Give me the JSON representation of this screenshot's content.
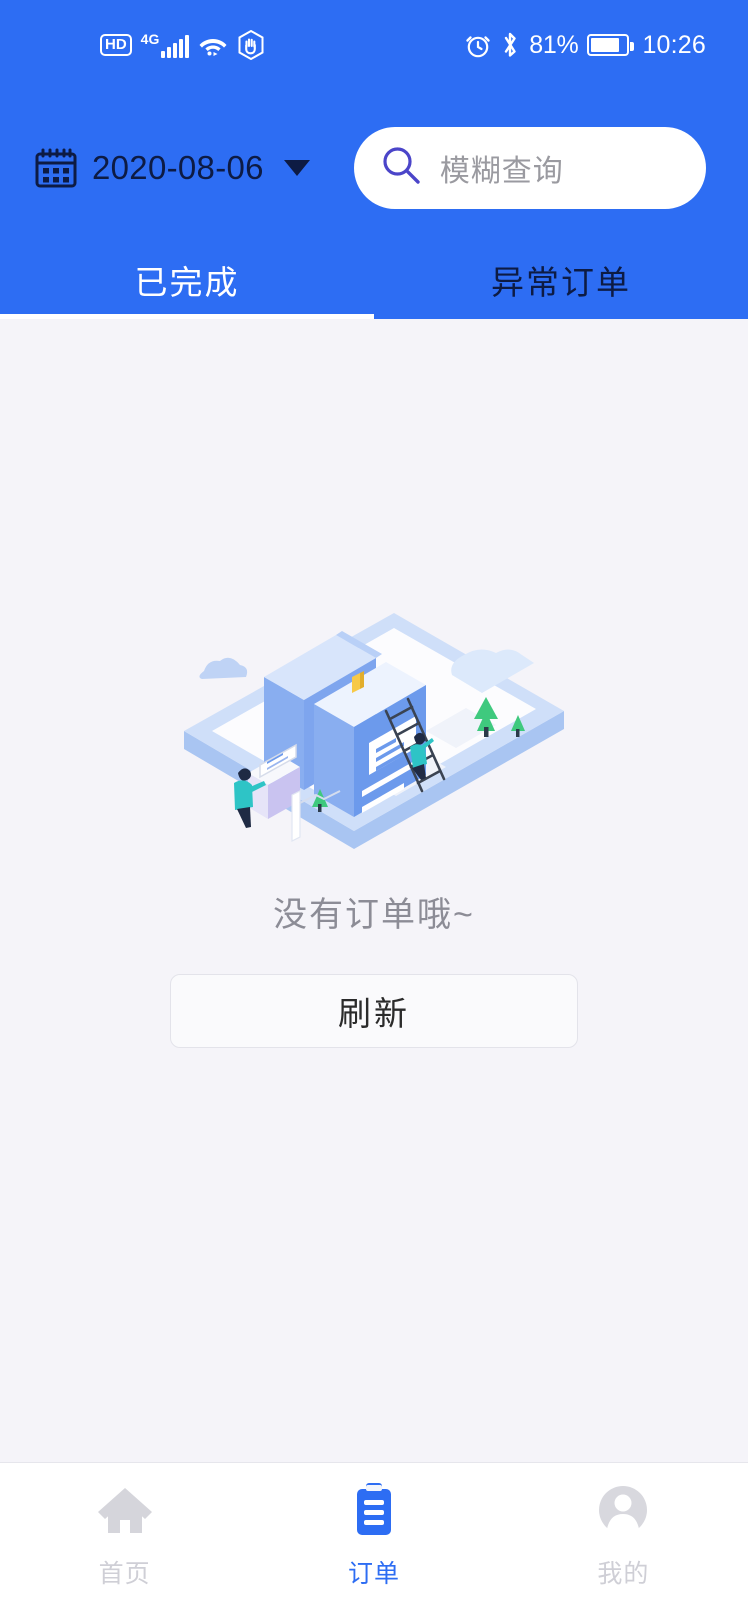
{
  "status_bar": {
    "hd_badge": "HD",
    "network_type": "4G",
    "signal_icon": "signal-bars-icon",
    "wifi_icon": "wifi-icon",
    "dnd_icon": "do-not-disturb-hand-icon",
    "alarm_icon": "alarm-clock-icon",
    "bluetooth_icon": "bluetooth-icon",
    "battery_percent": "81%",
    "battery_icon": "battery-icon",
    "time": "10:26"
  },
  "header": {
    "calendar_icon": "calendar-icon",
    "date": "2020-08-06",
    "caret_icon": "chevron-down-icon",
    "search": {
      "icon": "search-icon",
      "placeholder": "模糊查询",
      "value": ""
    },
    "tabs": [
      {
        "label": "已完成",
        "active": true
      },
      {
        "label": "异常订单",
        "active": false
      }
    ]
  },
  "main": {
    "illustration": "empty-orders-isometric-illustration",
    "empty_text": "没有订单哦~",
    "refresh_label": "刷新"
  },
  "bottom_nav": [
    {
      "label": "首页",
      "icon": "home-icon",
      "active": false
    },
    {
      "label": "订单",
      "icon": "clipboard-icon",
      "active": true
    },
    {
      "label": "我的",
      "icon": "user-avatar-icon",
      "active": false
    }
  ],
  "colors": {
    "brand_blue": "#2D6DF3",
    "header_text_dark": "#0D1B44",
    "content_bg": "#F5F4F9",
    "muted_text": "#8C8C96",
    "nav_idle": "#CFCFD6",
    "search_icon": "#4B45C9"
  }
}
